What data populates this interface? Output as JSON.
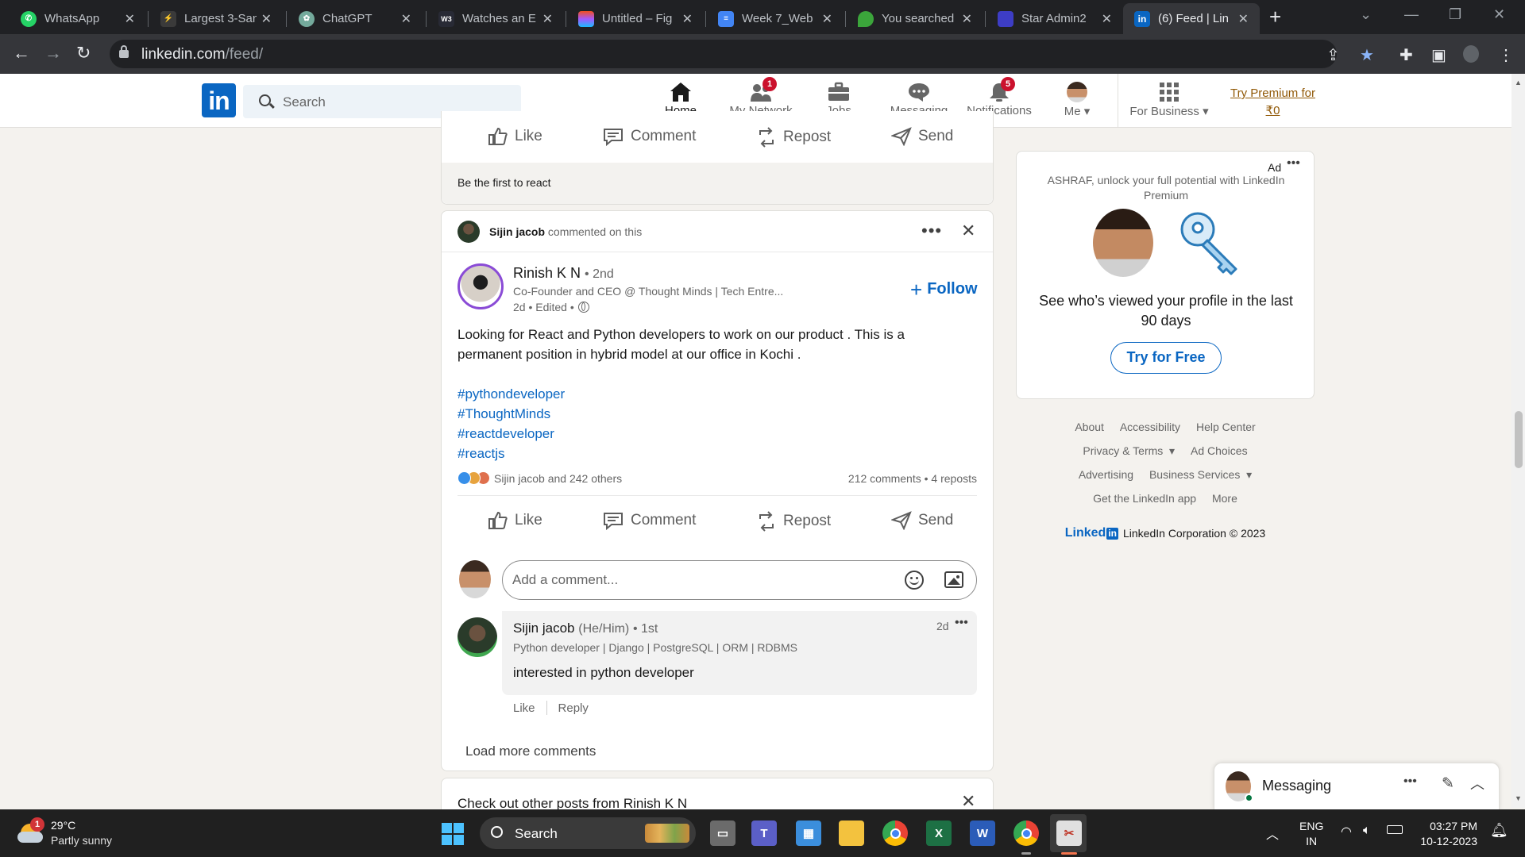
{
  "browser": {
    "tabs": [
      {
        "title": "WhatsApp",
        "icon": "whatsapp-icon"
      },
      {
        "title": "Largest 3-San",
        "icon": "site-icon"
      },
      {
        "title": "ChatGPT",
        "icon": "chatgpt-icon"
      },
      {
        "title": "Watches an E",
        "icon": "w3schools-icon"
      },
      {
        "title": "Untitled – Fig",
        "icon": "figma-icon"
      },
      {
        "title": "Week 7_Web",
        "icon": "docs-icon"
      },
      {
        "title": "You searched",
        "icon": "leaf-icon"
      },
      {
        "title": "Star Admin2",
        "icon": "admin-icon"
      },
      {
        "title": "(6) Feed | Lin",
        "icon": "linkedin-icon"
      }
    ],
    "url_host": "linkedin.com",
    "url_path": "/feed/"
  },
  "header": {
    "search_placeholder": "Search",
    "nav": [
      {
        "label": "Home"
      },
      {
        "label": "My Network",
        "badge": "1"
      },
      {
        "label": "Jobs"
      },
      {
        "label": "Messaging"
      },
      {
        "label": "Notifications",
        "badge": "5"
      },
      {
        "label": "Me"
      },
      {
        "label": "For Business"
      }
    ],
    "premium_line1": "Try Premium for",
    "premium_line2": "₹0"
  },
  "prev_post": {
    "actions": [
      "Like",
      "Comment",
      "Repost",
      "Send"
    ],
    "reactions_text": "Be the first to react"
  },
  "post": {
    "context_name": "Sijin jacob",
    "context_text": "commented on this",
    "author_name": "Rinish K N",
    "author_degree": "• 2nd",
    "author_headline": "Co-Founder and CEO @ Thought Minds | Tech Entre...",
    "meta": "2d • Edited •",
    "follow_label": "Follow",
    "body_line1": "Looking for React and Python developers to work on our product . This is a",
    "body_line2": "permanent position in hybrid model at our office in Kochi .",
    "hashtags": [
      "#pythondeveloper",
      "#ThoughtMinds",
      "#reactdeveloper",
      "#reactjs"
    ],
    "reactions_text": "Sijin jacob and 242 others",
    "counts_text": "212 comments • 4 reposts",
    "actions": [
      "Like",
      "Comment",
      "Repost",
      "Send"
    ],
    "comment_placeholder": "Add a comment...",
    "comment": {
      "name": "Sijin jacob",
      "pronouns": "(He/Him)",
      "degree": "• 1st",
      "headline": "Python developer | Django | PostgreSQL | ORM | RDBMS",
      "time": "2d",
      "text": "interested in python developer",
      "like": "Like",
      "reply": "Reply"
    },
    "load_more": "Load more comments"
  },
  "next_card_title": "Check out other posts from Rinish K N",
  "ad": {
    "label": "Ad",
    "line1": "ASHRAF, unlock your full potential with LinkedIn",
    "line2": "Premium",
    "headline1": "See who’s viewed your profile in the last",
    "headline2": "90 days",
    "cta": "Try for Free"
  },
  "footer": {
    "row1": [
      "About",
      "Accessibility",
      "Help Center"
    ],
    "row2": [
      "Privacy & Terms",
      "Ad Choices"
    ],
    "row3": [
      "Advertising",
      "Business Services"
    ],
    "row4": [
      "Get the LinkedIn app",
      "More"
    ],
    "brand_text": "Linked",
    "brand_in": "in",
    "copyright": "LinkedIn Corporation © 2023"
  },
  "messaging": {
    "label": "Messaging"
  },
  "taskbar": {
    "weather_badge": "1",
    "temp": "29°C",
    "condition": "Partly sunny",
    "search_label": "Search",
    "lang1": "ENG",
    "lang2": "IN",
    "time": "03:27 PM",
    "date": "10-12-2023"
  },
  "colors": {
    "brand": "#0a66c2",
    "badge": "#cb112d",
    "premium": "#915907"
  }
}
